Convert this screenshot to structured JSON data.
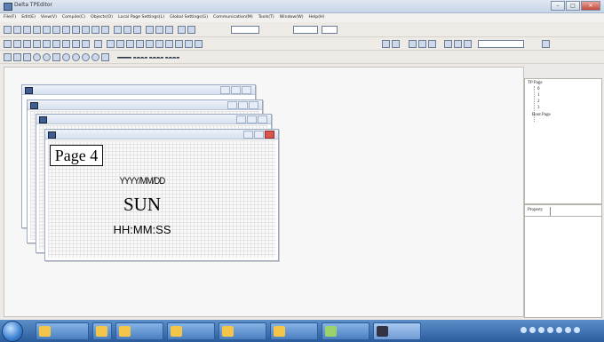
{
  "window": {
    "title": "Delta TPEditor"
  },
  "menu": [
    "File(F)",
    "Edit(E)",
    "View(V)",
    "Compile(C)",
    "Objects(O)",
    "Local Page Settings(L)",
    "Global Settings(G)",
    "Communication(M)",
    "Tools(T)",
    "Window(W)",
    "Help(H)"
  ],
  "canvas": {
    "page_label": "Page 4",
    "date_text": "YYYY/MM/DD",
    "day_text": "SUN",
    "time_text": "HH:MM:SS"
  },
  "tree": {
    "root": "TP Page",
    "children": [
      "0",
      "1",
      "2",
      "3"
    ],
    "boot_page": "Boot Page"
  },
  "property_panel": {
    "header": "Property"
  },
  "colors": {
    "titlebar": "#c8d6e8",
    "taskbar": "#2a5c9e",
    "close_button": "#c7483b"
  }
}
